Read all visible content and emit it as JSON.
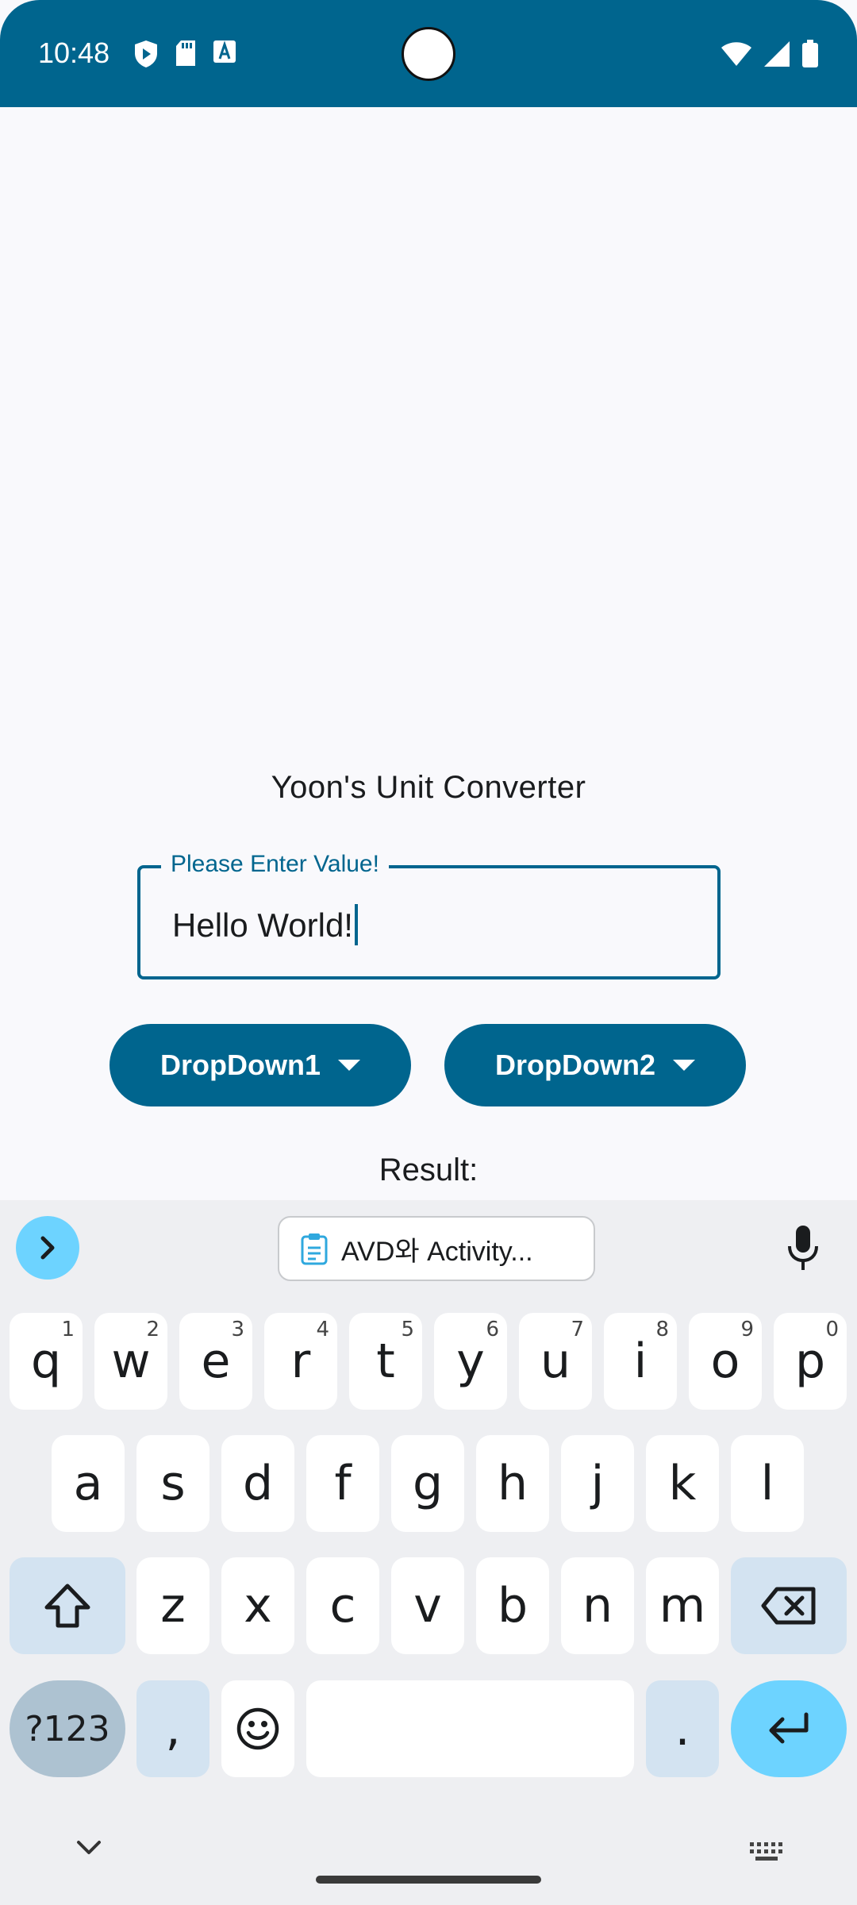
{
  "status_bar": {
    "time": "10:48",
    "left_icons": [
      "play-protect-icon",
      "sd-card-icon",
      "text-a-icon"
    ],
    "right_icons": [
      "wifi-icon",
      "signal-icon",
      "battery-icon"
    ],
    "color": "#00658e"
  },
  "app": {
    "title": "Yoon's Unit Converter",
    "input": {
      "label": "Please Enter Value!",
      "value": "Hello World!"
    },
    "dropdown1": {
      "label": "DropDown1"
    },
    "dropdown2": {
      "label": "DropDown2"
    },
    "result_label": "Result:"
  },
  "keyboard": {
    "clipboard_suggestion": "AVD와 Activity...",
    "row1": [
      {
        "k": "q",
        "s": "1"
      },
      {
        "k": "w",
        "s": "2"
      },
      {
        "k": "e",
        "s": "3"
      },
      {
        "k": "r",
        "s": "4"
      },
      {
        "k": "t",
        "s": "5"
      },
      {
        "k": "y",
        "s": "6"
      },
      {
        "k": "u",
        "s": "7"
      },
      {
        "k": "i",
        "s": "8"
      },
      {
        "k": "o",
        "s": "9"
      },
      {
        "k": "p",
        "s": "0"
      }
    ],
    "row2": [
      "a",
      "s",
      "d",
      "f",
      "g",
      "h",
      "j",
      "k",
      "l"
    ],
    "row3": [
      "z",
      "x",
      "c",
      "v",
      "b",
      "n",
      "m"
    ],
    "symbols_key": "?123",
    "comma_key": ",",
    "period_key": "."
  },
  "colors": {
    "primary": "#00658e",
    "accent": "#6dd3ff",
    "mod_key": "#d3e3f1"
  }
}
